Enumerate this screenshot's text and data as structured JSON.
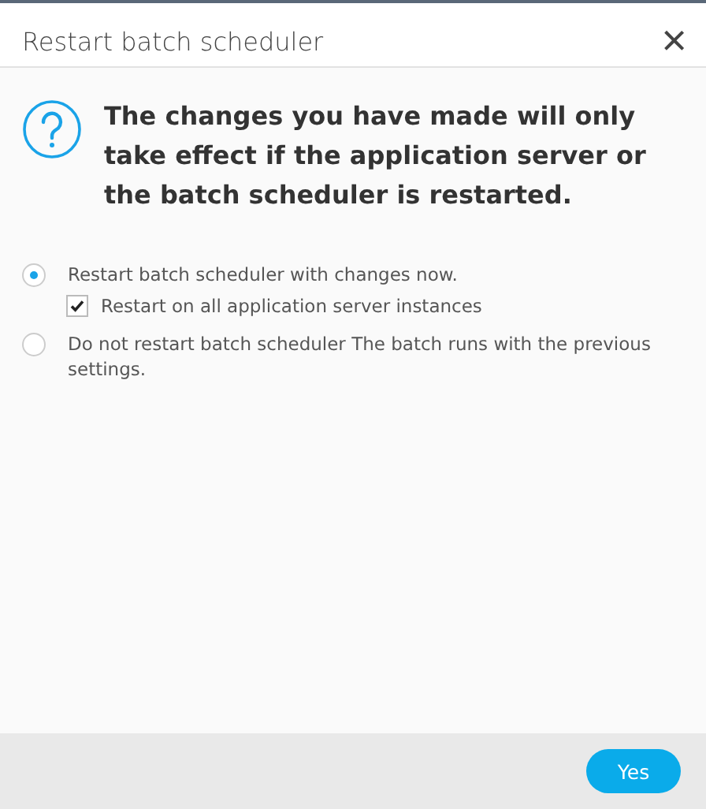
{
  "dialog": {
    "title": "Restart batch scheduler",
    "close": "×"
  },
  "message": "The changes you have made will only take effect if the application server or the batch scheduler is restarted.",
  "options": [
    {
      "label": "Restart batch scheduler with changes now.",
      "selected": true,
      "children": [
        {
          "label": "Restart on all application server instances",
          "checked": true
        }
      ]
    },
    {
      "label": "Do not restart batch scheduler The batch runs with the previous settings.",
      "selected": false
    }
  ],
  "buttons": [
    {
      "label": "Yes"
    }
  ]
}
